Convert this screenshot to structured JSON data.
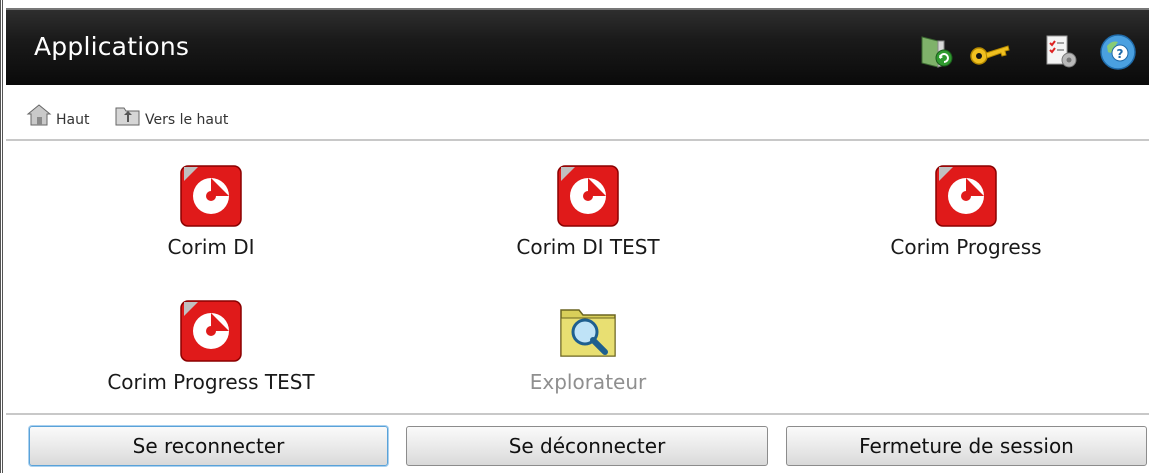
{
  "header": {
    "title": "Applications",
    "icons": [
      "refresh-door-icon",
      "key-icon",
      "settings-checklist-icon",
      "help-icon"
    ]
  },
  "breadcrumb": {
    "home_label": "Haut",
    "up_label": "Vers le haut"
  },
  "apps": [
    {
      "label": "Corim DI",
      "icon": "corim-app-icon"
    },
    {
      "label": "Corim DI TEST",
      "icon": "corim-app-icon"
    },
    {
      "label": "Corim Progress",
      "icon": "corim-app-icon"
    },
    {
      "label": "Corim Progress TEST",
      "icon": "corim-app-icon"
    },
    {
      "label": "Explorateur",
      "icon": "folder-search-icon",
      "disabled": true
    }
  ],
  "buttons": {
    "reconnect": "Se reconnecter",
    "disconnect": "Se déconnecter",
    "logout": "Fermeture de session"
  },
  "colors": {
    "titlebar": "#141414",
    "corim_red": "#e01a1a",
    "disabled_text": "#8f8f8f",
    "focus_border": "#5aa2d8"
  }
}
